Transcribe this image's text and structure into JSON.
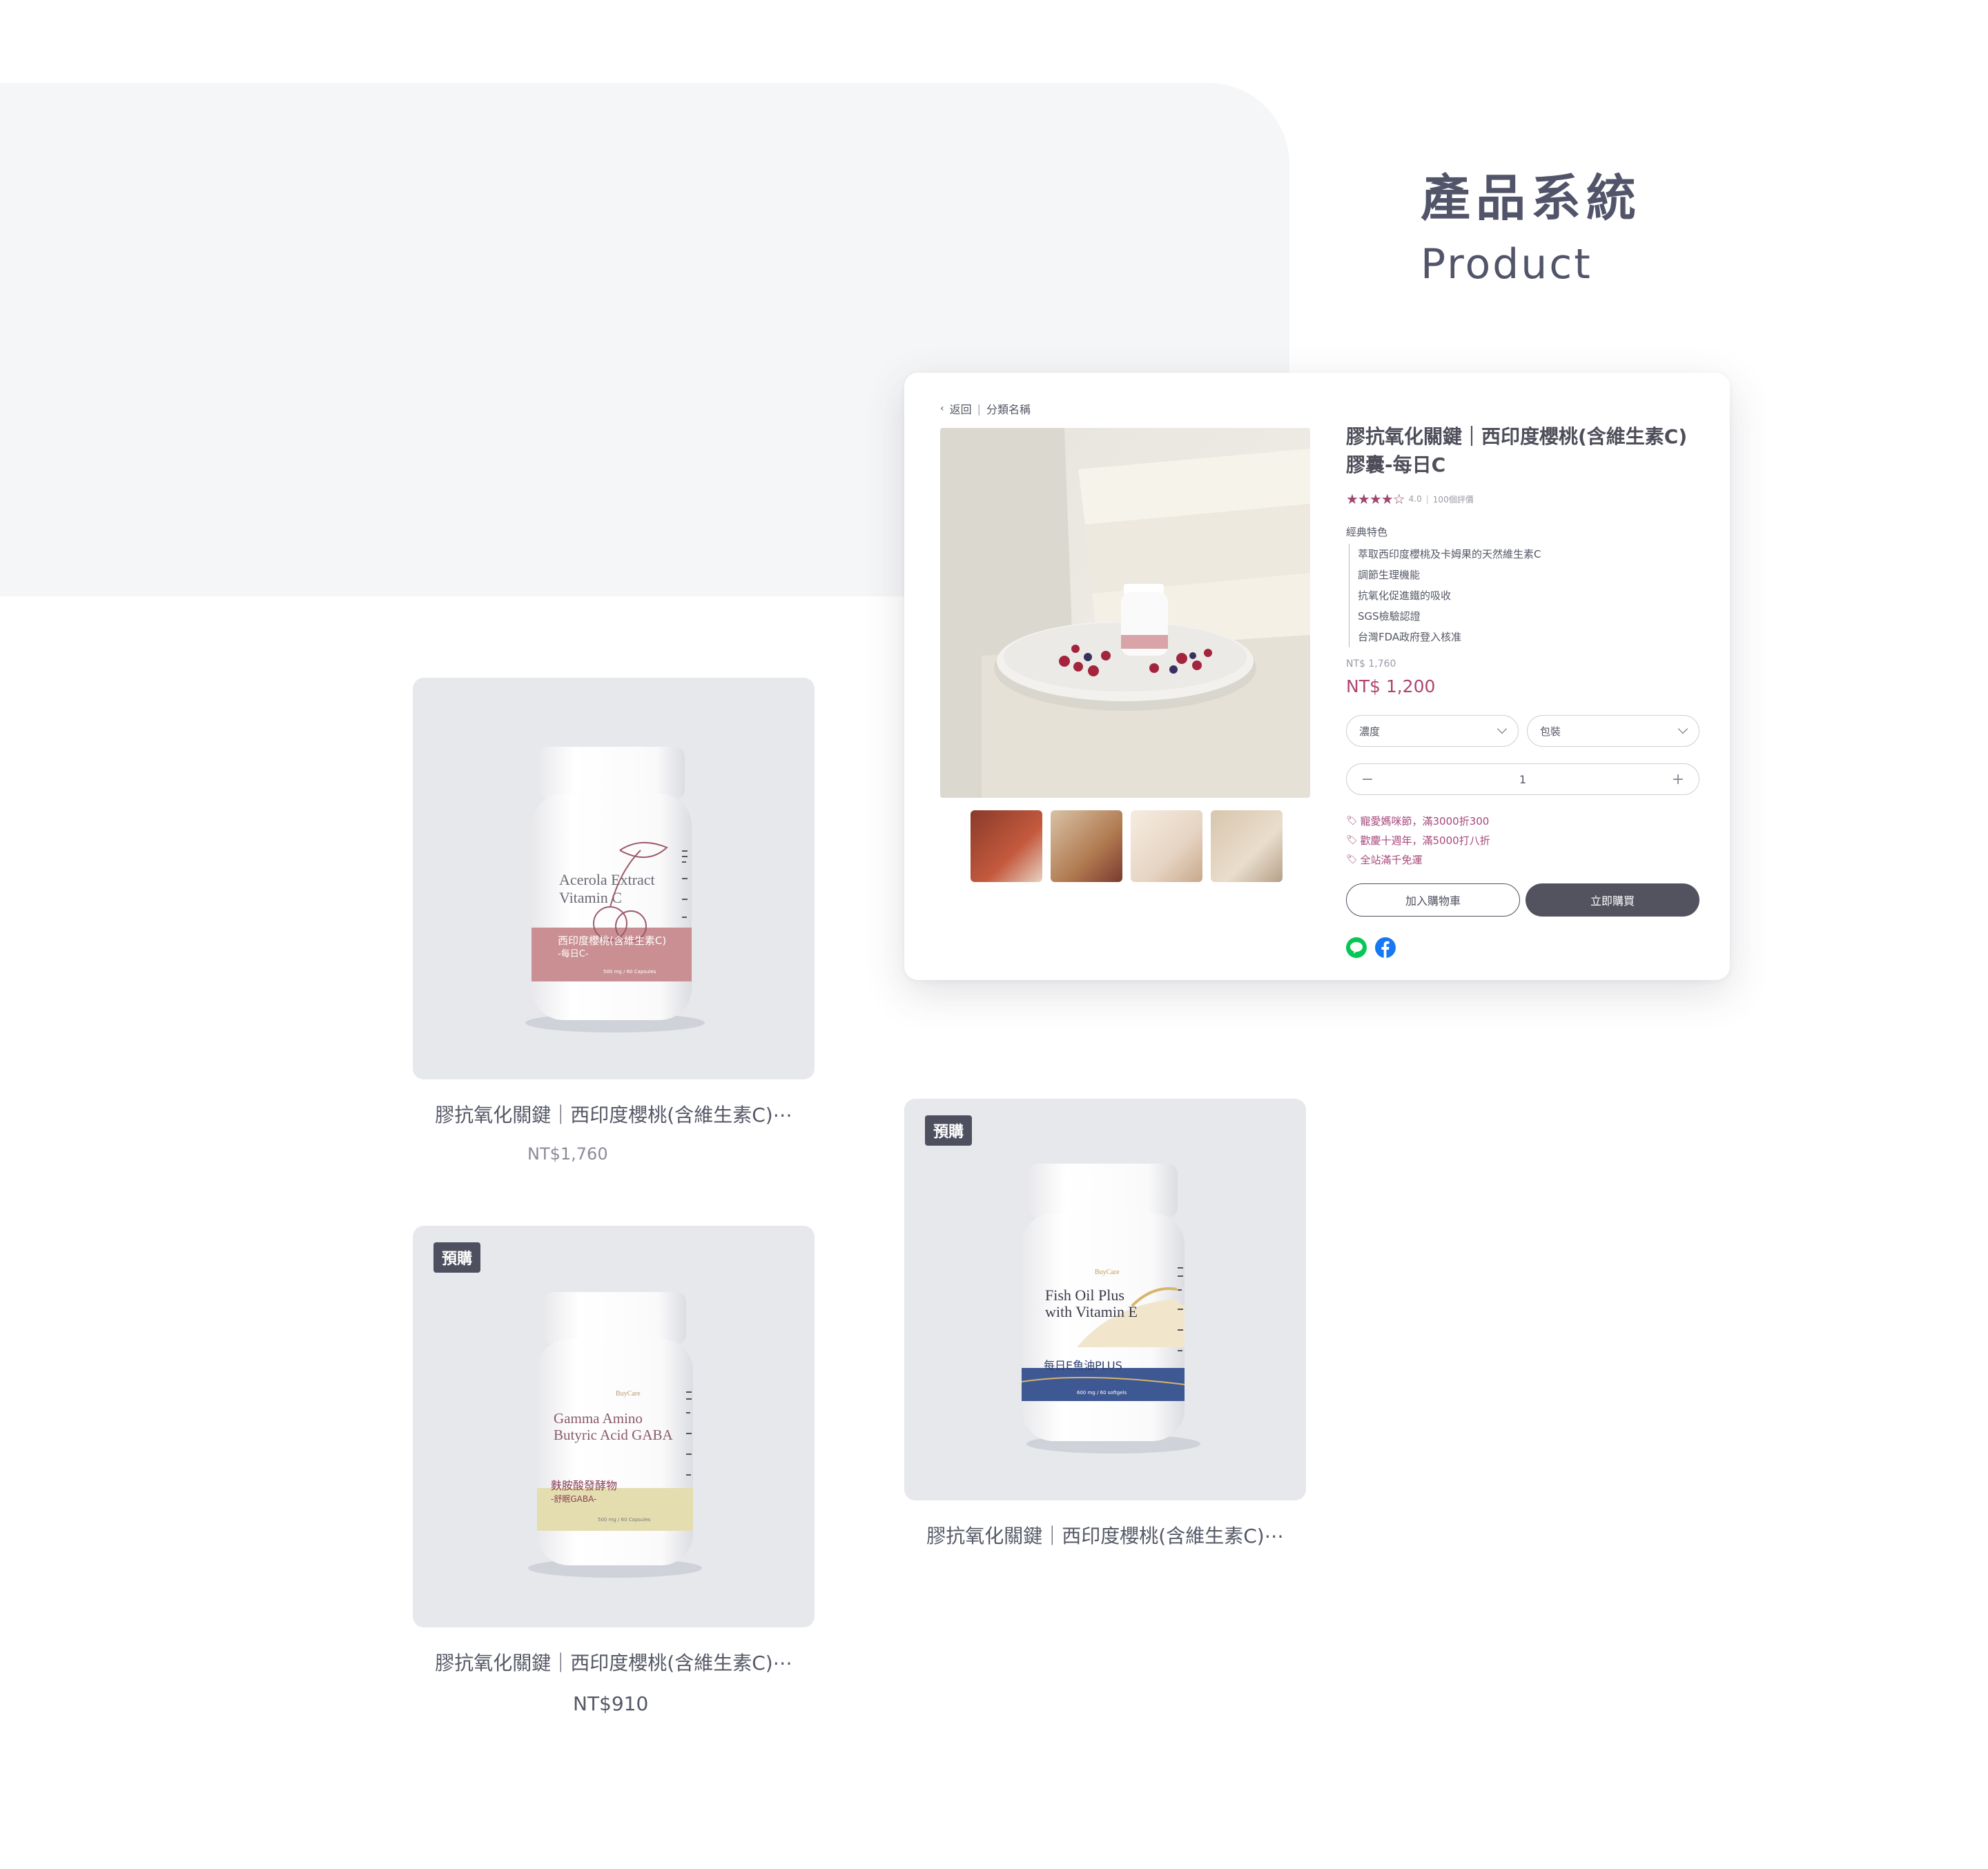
{
  "section": {
    "title": "產品系統",
    "subtitle": "Product"
  },
  "detail": {
    "breadcrumb": {
      "back": "返回",
      "category": "分類名稱"
    },
    "title": "膠抗氧化關鍵｜西印度櫻桃(含維生素C)膠囊-每日C",
    "rating": {
      "stars": 4,
      "score": "4.0",
      "reviews": "100個評價"
    },
    "features_title": "經典特色",
    "features": [
      "萃取西印度櫻桃及卡姆果的天然維生素C",
      "調節生理機能",
      "抗氧化促進鐵的吸收",
      "SGS檢驗認證",
      "台灣FDA政府登入核准"
    ],
    "old_price": "NT$ 1,760",
    "price": "NT$ 1,200",
    "select_concentration": "濃度",
    "select_package": "包裝",
    "quantity": "1",
    "promos": [
      "寵愛媽咪節，滿3000折300",
      "歡慶十週年，滿5000打八折",
      "全站滿千免運"
    ],
    "add_to_cart": "加入購物車",
    "buy_now": "立即購買",
    "share_icons": [
      "line-icon",
      "facebook-icon"
    ]
  },
  "products": [
    {
      "name": "膠抗氧化關鍵｜西印度櫻桃(含維生素C)⋯",
      "price": "NT$1,760",
      "badge": "",
      "label_en_1": "Acerola Extract",
      "label_en_2": "Vitamin C",
      "label_zh": "西印度櫻桃(含維生素C)",
      "label_sub": "-每日C-",
      "label_spec": "500 mg / 60 Capsules",
      "accent": "#c98f92"
    },
    {
      "name": "膠抗氧化關鍵｜西印度櫻桃(含維生素C)⋯",
      "price": "",
      "badge": "預購",
      "label_brand": "BuyCare",
      "label_en_1": "Fish Oil Plus",
      "label_en_2": "with Vitamin E",
      "label_zh": "每日E魚油PLUS",
      "label_spec": "600 mg / 60 softgels",
      "accent": "#3e5893"
    },
    {
      "name": "膠抗氧化關鍵｜西印度櫻桃(含維生素C)⋯",
      "price": "NT$910",
      "badge": "預購",
      "label_brand": "BuyCare",
      "label_en_1": "Gamma Amino",
      "label_en_2": "Butyric Acid GABA",
      "label_zh": "麩胺酸發酵物",
      "label_sub": "-舒眠GABA-",
      "label_spec": "500 mg / 60 Capsules",
      "accent": "#e4ddb0"
    }
  ],
  "colors": {
    "accent_rose": "#b0456f",
    "dark": "#52535f",
    "card_bg": "#e6e8ec",
    "panel_bg": "#f5f6f7"
  }
}
